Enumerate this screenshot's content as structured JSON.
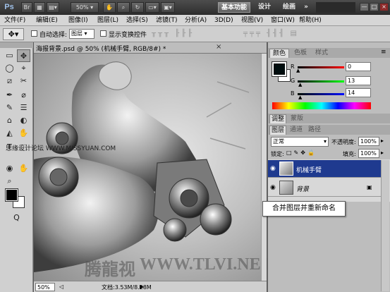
{
  "app": {
    "logo": "Ps",
    "zoom": "50%",
    "workspaces": [
      "基本功能",
      "设计",
      "绘画"
    ],
    "more": "»",
    "window_buttons": [
      "—",
      "□",
      "×"
    ]
  },
  "menu": [
    "文件(F)",
    "编辑(E)",
    "图像(I)",
    "图层(L)",
    "选择(S)",
    "滤镜(T)",
    "分析(A)",
    "3D(D)",
    "视图(V)",
    "窗口(W)",
    "帮助(H)"
  ],
  "options": {
    "auto_select_label": "自动选择:",
    "auto_select_value": "图层",
    "show_transform_label": "显示变换控件"
  },
  "document": {
    "tab_title": "海报背景.psd @ 50% (机械手臂, RGB/8#) *",
    "tab_close": "×",
    "zoom": "50%",
    "doc_info": "文档:3.53M/8.28M"
  },
  "toolbox": {
    "tools": [
      "▭",
      "✥",
      "◯",
      "⌖",
      "⧄",
      "✂",
      "✒",
      "⌀",
      "✎",
      "☰",
      "⌂",
      "◐",
      "◭",
      "✋",
      "T",
      "⬚",
      "◉",
      "Q"
    ],
    "fg_color": "#000000",
    "bg_color": "#ffffff"
  },
  "color_panel": {
    "tabs": [
      "颜色",
      "色板",
      "样式"
    ],
    "r_label": "R",
    "g_label": "G",
    "b_label": "B",
    "r": "0",
    "g": "13",
    "b": "14",
    "r_fraction": 0.0,
    "g_fraction": 0.05,
    "b_fraction": 0.055,
    "swatch": "#000d0e"
  },
  "adjust_panel": {
    "tabs": [
      "调整",
      "蒙版"
    ]
  },
  "layers_panel": {
    "tabs": [
      "图层",
      "通道",
      "路径"
    ],
    "blend_mode": "正常",
    "opacity_label": "不透明度:",
    "opacity": "100%",
    "lock_label": "锁定:",
    "fill_label": "填充:",
    "fill": "100%",
    "layers": [
      {
        "name": "机械手臂",
        "selected": true
      },
      {
        "name": "背景",
        "selected": false,
        "locked": true
      }
    ]
  },
  "callout": "合并图层并重新命名",
  "watermarks": {
    "left": "思缘设计论坛 WWW.MISSYUAN.COM",
    "bottom": "WWW.TLVI.NET",
    "bottom_prefix": "腾龍视"
  }
}
